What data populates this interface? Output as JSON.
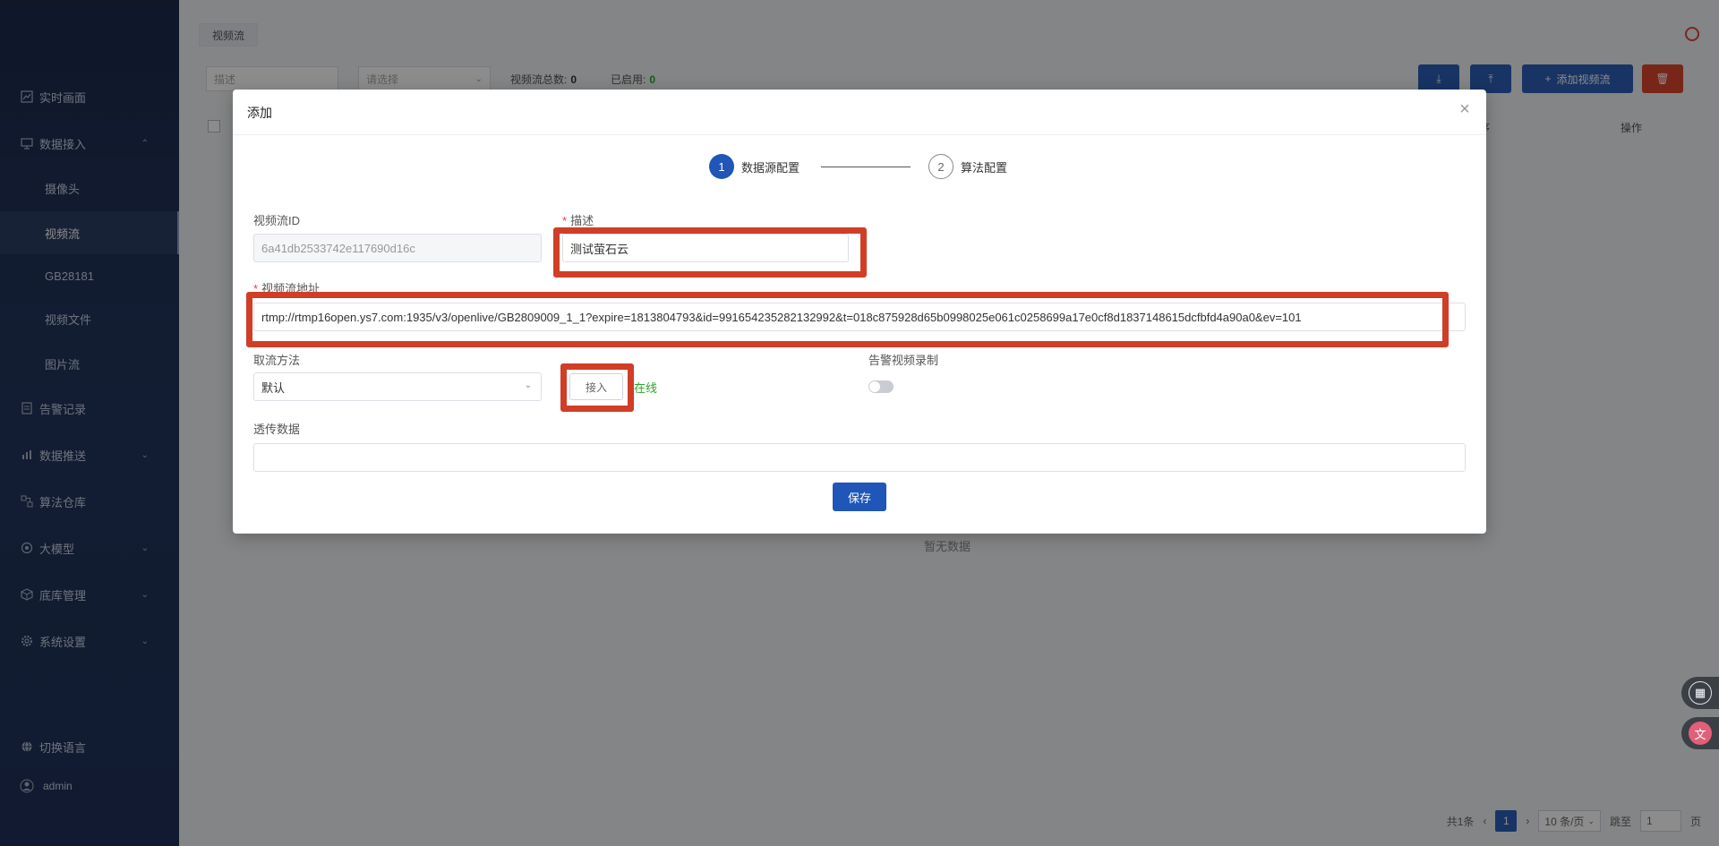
{
  "sidebar": {
    "items": [
      {
        "label": "实时画面",
        "icon": "chart-icon"
      },
      {
        "label": "数据接入",
        "icon": "monitor-icon"
      },
      {
        "label": "摄像头"
      },
      {
        "label": "视频流"
      },
      {
        "label": "GB28181"
      },
      {
        "label": "视频文件"
      },
      {
        "label": "图片流"
      },
      {
        "label": "告警记录",
        "icon": "document-icon"
      },
      {
        "label": "数据推送",
        "icon": "bar-chart-icon"
      },
      {
        "label": "算法仓库",
        "icon": "workflow-icon"
      },
      {
        "label": "大模型",
        "icon": "brain-icon"
      },
      {
        "label": "底库管理",
        "icon": "box-icon"
      },
      {
        "label": "系统设置",
        "icon": "gear-icon"
      }
    ],
    "language": "切换语言",
    "user": "admin"
  },
  "page": {
    "tab": "视频流",
    "filter_desc_placeholder": "描述",
    "filter_select_placeholder": "请选择",
    "total_label": "视频流总数:",
    "total_value": "0",
    "enabled_label": "已启用:",
    "enabled_value": "0",
    "add_button": "添加视频流",
    "col_sort": "排序",
    "col_action": "操作",
    "no_data": "暂无数据",
    "pager": {
      "total": "共1条",
      "page": "1",
      "page_size": "10 条/页",
      "goto_label": "跳至",
      "goto_value": "1",
      "page_suffix": "页"
    }
  },
  "dialog": {
    "title": "添加",
    "steps": [
      {
        "num": "1",
        "label": "数据源配置"
      },
      {
        "num": "2",
        "label": "算法配置"
      }
    ],
    "stream_id_label": "视频流ID",
    "stream_id_value": "6a41db2533742e117690d16c",
    "desc_label": "描述",
    "desc_value": "测试萤石云",
    "url_label": "视频流地址",
    "url_value": "rtmp://rtmp16open.ys7.com:1935/v3/openlive/GB2809009_1_1?expire=1813804793&id=991654235282132992&t=018c875928d65b0998025e061c0258699a17e0cf8d1837148615dcfbfd4a90a0&ev=101",
    "method_label": "取流方法",
    "method_value": "默认",
    "connect_button": "接入",
    "status": "在线",
    "alarm_record_label": "告警视频录制",
    "passthrough_label": "透传数据",
    "save_button": "保存"
  },
  "colors": {
    "primary": "#1f56b8",
    "highlight": "#d03e27",
    "online": "#2aa52a",
    "sidebar": "#1f3158"
  }
}
